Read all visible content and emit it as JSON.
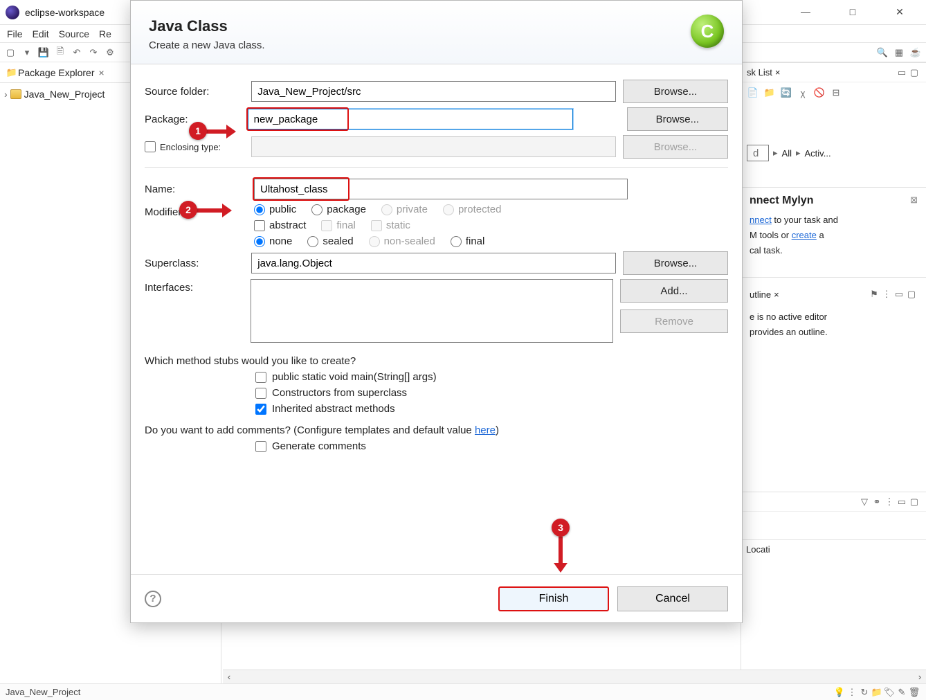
{
  "window": {
    "title": "eclipse-workspace",
    "controls": {
      "min": "—",
      "max": "□",
      "close": "✕"
    }
  },
  "menu": {
    "file": "File",
    "edit": "Edit",
    "source": "Source",
    "refactor": "Re"
  },
  "package_explorer": {
    "title": "Package Explorer",
    "project": "Java_New_Project"
  },
  "task_list": {
    "title": "sk List",
    "filter_all": "All",
    "filter_activ": "Activ...",
    "filter_d_placeholder": "d"
  },
  "mylyn": {
    "title": "nnect Mylyn",
    "link1": "nnect",
    "text1": " to your task and",
    "text2": "M tools or ",
    "link2": "create",
    "text3": " a",
    "text4": "cal task."
  },
  "outline": {
    "title": "utline",
    "text1": "e is no active editor",
    "text2": "provides an outline."
  },
  "problems": {
    "col_location": "Locati"
  },
  "statusbar": {
    "project": "Java_New_Project"
  },
  "dialog": {
    "title": "Java Class",
    "subtitle": "Create a new Java class.",
    "icon_letter": "C",
    "labels": {
      "source_folder": "Source folder:",
      "package": "Package:",
      "enclosing_type": "Enclosing type:",
      "name": "Name:",
      "modifiers": "Modifiers:",
      "superclass": "Superclass:",
      "interfaces": "Interfaces:",
      "stubs_q": "Which method stubs would you like to create?",
      "stub_main": "public static void main(String[] args)",
      "stub_ctor": "Constructors from superclass",
      "stub_inherit": "Inherited abstract methods",
      "comments_q": "Do you want to add comments? (Configure templates and default value ",
      "comments_here": "here",
      "comments_close": ")",
      "gen_comments": "Generate comments"
    },
    "values": {
      "source_folder": "Java_New_Project/src",
      "package": "new_package",
      "name": "Ultahost_class",
      "superclass": "java.lang.Object"
    },
    "modifiers": {
      "public": "public",
      "package": "package",
      "private": "private",
      "protected": "protected",
      "abstract": "abstract",
      "final": "final",
      "static": "static",
      "none": "none",
      "sealed": "sealed",
      "non_sealed": "non-sealed",
      "final2": "final"
    },
    "buttons": {
      "browse": "Browse...",
      "add": "Add...",
      "remove": "Remove",
      "finish": "Finish",
      "cancel": "Cancel"
    }
  },
  "callouts": {
    "b1": "1",
    "b2": "2",
    "b3": "3"
  }
}
